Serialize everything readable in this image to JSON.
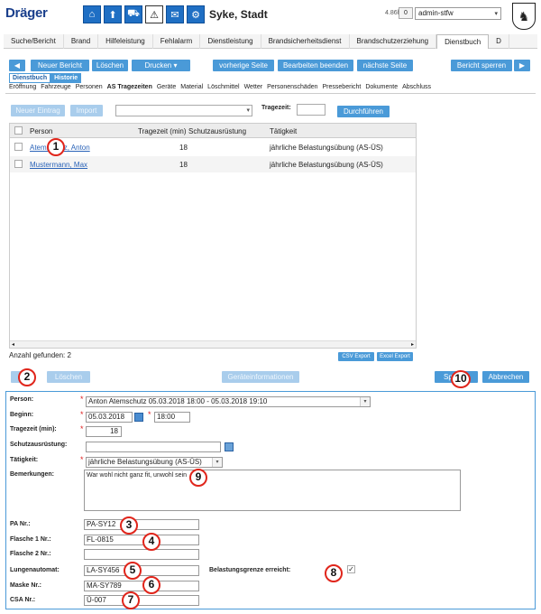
{
  "header": {
    "logo": "Dräger",
    "station": "Syke, Stadt",
    "version": "4.86h",
    "badge": "0",
    "user": "admin-stfw",
    "icons": [
      "home-icon",
      "upload-icon",
      "truck-icon",
      "beacon-icon",
      "mail-icon",
      "gear-icon",
      "layers-icon"
    ]
  },
  "nav_tabs": [
    "Suche/Bericht",
    "Brand",
    "Hilfeleistung",
    "Fehlalarm",
    "Dienstleistung",
    "Brandsicherheitsdienst",
    "Brandschutzerziehung",
    "Dienstbuch",
    "D"
  ],
  "toolbar": {
    "prev": "◀",
    "new_report": "Neuer Bericht",
    "delete": "Löschen",
    "print": "Drucken",
    "prev_page": "vorherige Seite",
    "end_edit": "Bearbeiten beenden",
    "next_page": "nächste Seite",
    "lock_report": "Bericht sperren",
    "next": "▶"
  },
  "subtabs": [
    "Dienstbuch",
    "Historie"
  ],
  "section_links": [
    "Eröffnung",
    "Fahrzeuge",
    "Personen",
    "AS Tragezeiten",
    "Geräte",
    "Material",
    "Löschmittel",
    "Wetter",
    "Personenschäden",
    "Pressebericht",
    "Dokumente",
    "Abschluss"
  ],
  "filter": {
    "new_entry": "Neuer Eintrag",
    "import": "Import",
    "tragezeit_label": "Tragezeit:",
    "run": "Durchführen"
  },
  "grid": {
    "columns": [
      "Person",
      "Tragezeit (min)",
      "Schutzausrüstung",
      "Tätigkeit"
    ],
    "rows": [
      {
        "person": "Atemschutz, Anton",
        "tragezeit": "18",
        "schutz": "",
        "taetigkeit": "jährliche Belastungsübung (AS-ÜS)"
      },
      {
        "person": "Mustermann, Max",
        "tragezeit": "18",
        "schutz": "",
        "taetigkeit": "jährliche Belastungsübung (AS-ÜS)"
      }
    ],
    "found": "Anzahl gefunden: 2",
    "csv": "CSV Export",
    "excel": "Excel Export"
  },
  "actions": {
    "delete": "Löschen",
    "device_info": "Geräteinformationen",
    "save": "Sp",
    "cancel": "Abbrechen"
  },
  "form": {
    "person_label": "Person:",
    "person_value": "Anton Atemschutz 05.03.2018 18:00 - 05.03.2018 19:10",
    "begin_label": "Beginn:",
    "begin_date": "05.03.2018",
    "begin_time": "18:00",
    "tragezeit_label": "Tragezeit (min):",
    "tragezeit_value": "18",
    "schutz_label": "Schutzausrüstung:",
    "taetigkeit_label": "Tätigkeit:",
    "taetigkeit_value": "jährliche Belastungsübung (AS-ÜS)",
    "bemerk_label": "Bemerkungen:",
    "bemerk_value": "War wohl nicht ganz fit, unwohl sein",
    "pa_label": "PA Nr.:",
    "pa_value": "PA-SY12",
    "fl1_label": "Flasche 1 Nr.:",
    "fl1_value": "FL-0815",
    "fl2_label": "Flasche 2 Nr.:",
    "la_label": "Lungenautomat:",
    "la_value": "LA-SY456",
    "bel_label": "Belastungsgrenze erreicht:",
    "maske_label": "Maske Nr.:",
    "maske_value": "MA-SY789",
    "csa_label": "CSA Nr.:",
    "csa_value": "Ü-007"
  },
  "markers": [
    "1",
    "2",
    "3",
    "4",
    "5",
    "6",
    "7",
    "8",
    "9",
    "10"
  ],
  "colors": {
    "accent": "#4a9ad8",
    "marker": "#e0251b",
    "link": "#2a63b8"
  }
}
